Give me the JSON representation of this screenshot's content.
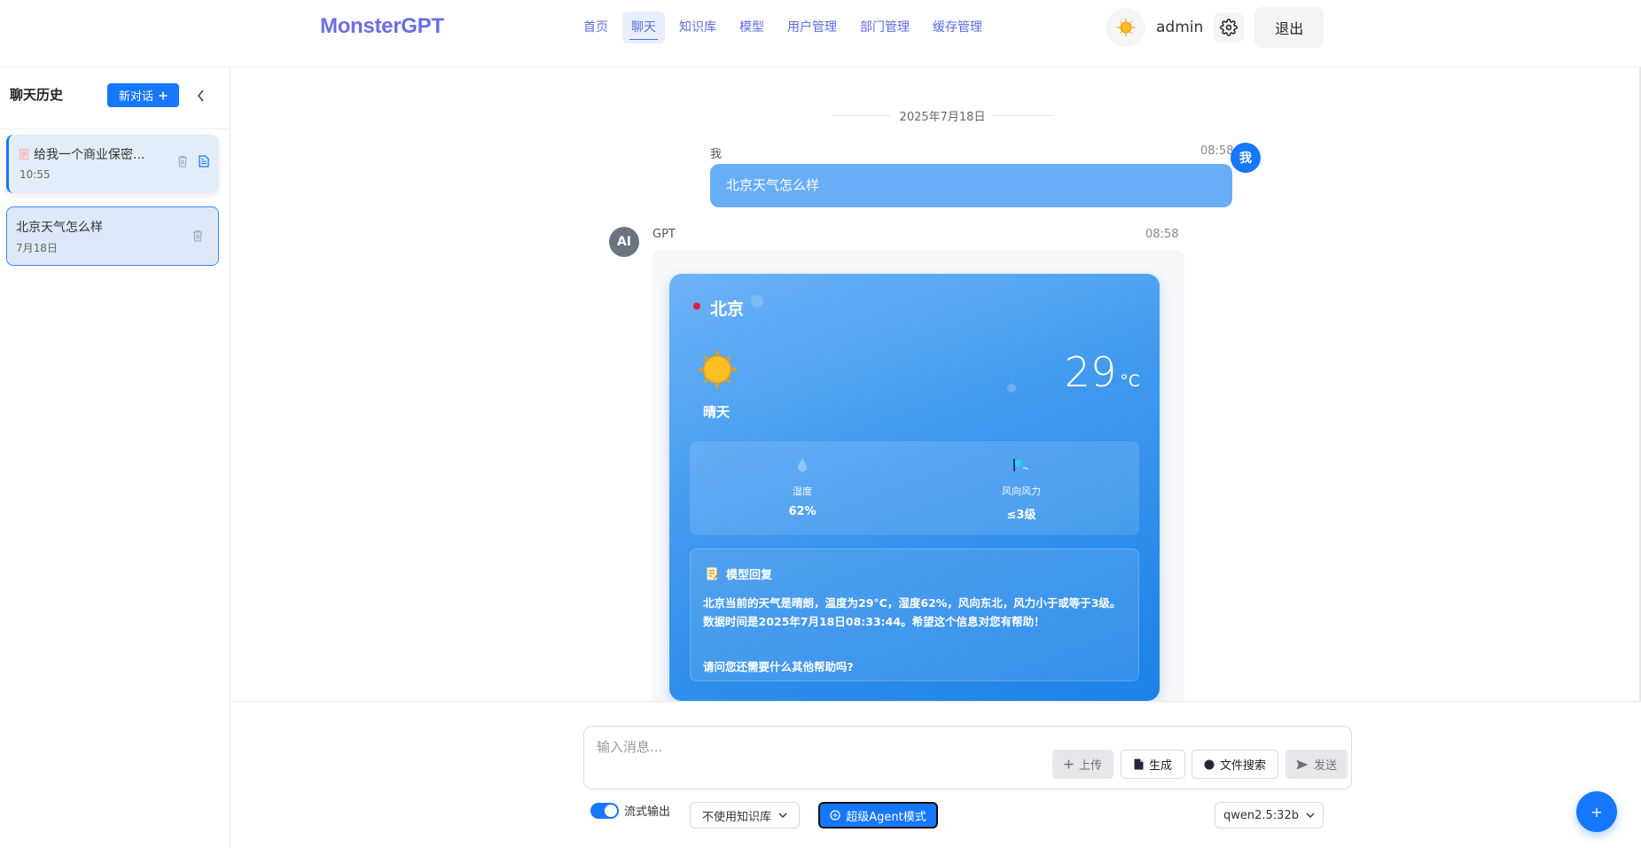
{
  "header": {
    "logo": "MonsterGPT",
    "nav": [
      "首页",
      "聊天",
      "知识库",
      "模型",
      "用户管理",
      "部门管理",
      "缓存管理"
    ],
    "active_nav": "聊天",
    "username": "admin",
    "logout_label": "退出"
  },
  "sidebar": {
    "title": "聊天历史",
    "new_chat_label": "新对话",
    "items": [
      {
        "title": "给我一个商业保密...",
        "time": "10:55"
      },
      {
        "title": "北京天气怎么样",
        "time": "7月18日"
      }
    ]
  },
  "chat": {
    "date": "2025年7月18日",
    "user_message": {
      "sender": "我",
      "time": "08:58",
      "avatar": "我",
      "text": "北京天气怎么样"
    },
    "ai_message": {
      "avatar": "AI",
      "sender": "GPT",
      "time": "08:58",
      "weather": {
        "city": "北京",
        "condition": "晴天",
        "temperature": "29",
        "unit": "°C",
        "humidity_label": "湿度",
        "humidity_value": "62%",
        "wind_label": "风向风力",
        "wind_value": "≤3级",
        "reply_title": "模型回复",
        "reply_text": "北京当前的天气是晴朗，温度为29°C，湿度62%，风向东北，风力小于或等于3级。数据时间是2025年7月18日08:33:44。希望这个信息对您有帮助！",
        "reply_question": "请问您还需要什么其他帮助吗?"
      }
    }
  },
  "composer": {
    "placeholder": "输入消息...",
    "upload_label": "上传",
    "generate_label": "生成",
    "file_search_label": "文件搜索",
    "send_label": "发送",
    "stream_label": "流式输出",
    "stream_enabled": true,
    "knowledge_select": "不使用知识库",
    "agent_label": "超级Agent模式",
    "model_select": "qwen2.5:32b",
    "fab_label": "+"
  },
  "colors": {
    "primary": "#1677ff",
    "logo": "#6b6ee8",
    "card_gradient_start": "#6db3f8",
    "card_gradient_end": "#1b82e6"
  }
}
